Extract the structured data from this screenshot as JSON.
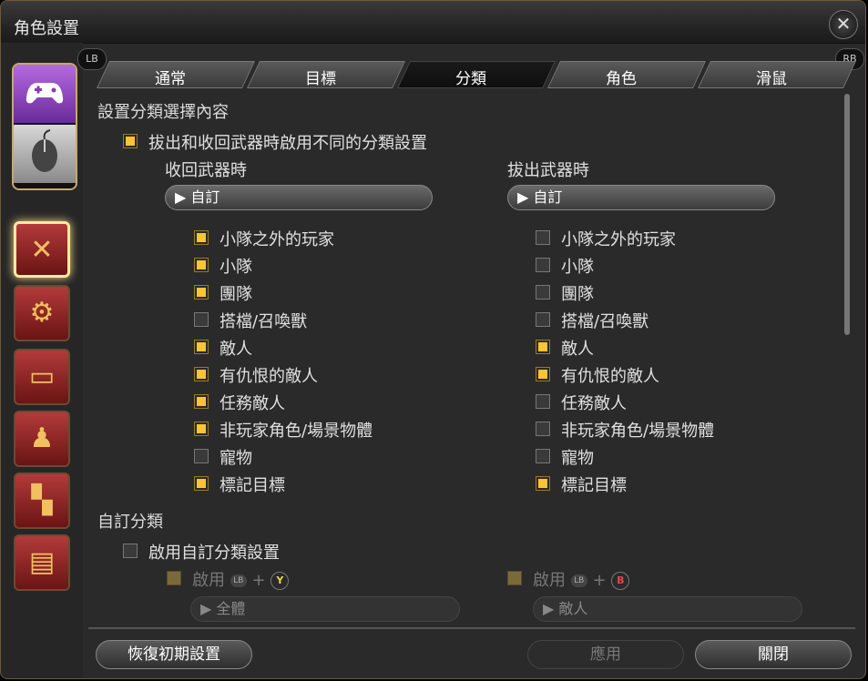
{
  "window": {
    "title": "角色設置",
    "close_icon": "close-icon"
  },
  "badges": {
    "left": "LB",
    "right": "RB"
  },
  "tabs": [
    {
      "label": "通常"
    },
    {
      "label": "目標"
    },
    {
      "label": "分類"
    },
    {
      "label": "角色"
    },
    {
      "label": "滑鼠"
    }
  ],
  "active_tab": "分類",
  "sidebar": {
    "device_icons": [
      "gamepad-icon",
      "mouse-icon"
    ],
    "items": [
      "crossed-arrows-icon",
      "gear-bag-icon",
      "card-icon",
      "character-icon",
      "checker-icon",
      "chat-icon"
    ]
  },
  "section1": {
    "heading": "設置分類選擇內容",
    "toggle_label": "拔出和收回武器時啟用不同的分類設置",
    "toggle_on": true,
    "left": {
      "heading": "收回武器時",
      "dropdown": "自訂",
      "items": [
        {
          "label": "小隊之外的玩家",
          "on": true
        },
        {
          "label": "小隊",
          "on": true
        },
        {
          "label": "團隊",
          "on": true
        },
        {
          "label": "搭檔/召喚獸",
          "on": false
        },
        {
          "label": "敵人",
          "on": true
        },
        {
          "label": "有仇恨的敵人",
          "on": true
        },
        {
          "label": "任務敵人",
          "on": true
        },
        {
          "label": "非玩家角色/場景物體",
          "on": true
        },
        {
          "label": "寵物",
          "on": false
        },
        {
          "label": "標記目標",
          "on": true
        }
      ]
    },
    "right": {
      "heading": "拔出武器時",
      "dropdown": "自訂",
      "items": [
        {
          "label": "小隊之外的玩家",
          "on": false
        },
        {
          "label": "小隊",
          "on": false
        },
        {
          "label": "團隊",
          "on": false
        },
        {
          "label": "搭檔/召喚獸",
          "on": false
        },
        {
          "label": "敵人",
          "on": true
        },
        {
          "label": "有仇恨的敵人",
          "on": true
        },
        {
          "label": "任務敵人",
          "on": false
        },
        {
          "label": "非玩家角色/場景物體",
          "on": false
        },
        {
          "label": "寵物",
          "on": false
        },
        {
          "label": "標記目標",
          "on": true
        }
      ]
    }
  },
  "section2": {
    "heading": "自訂分類",
    "toggle_label": "啟用自訂分類設置",
    "left": {
      "label": "啟用",
      "mini": "LB",
      "plus": "+",
      "key": "Y",
      "dropdown": "全體"
    },
    "right": {
      "label": "啟用",
      "mini": "LB",
      "plus": "+",
      "key": "B",
      "dropdown": "敵人"
    }
  },
  "buttons": {
    "reset": "恢復初期設置",
    "apply": "應用",
    "close": "關閉"
  },
  "colors": {
    "checkbox_on": "#ffc433",
    "key_y": "#e8d24a",
    "key_b": "#e04848"
  }
}
